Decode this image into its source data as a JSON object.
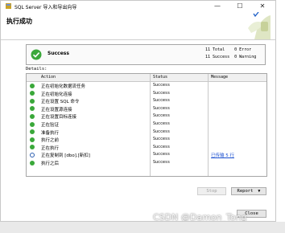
{
  "window": {
    "title": "SQL Server 导入和导出向导",
    "minimize": "—",
    "maximize": "☐",
    "close": "✕"
  },
  "header": {
    "heading": "执行成功"
  },
  "summary": {
    "status": "Success",
    "total_line": "11 Total    0 Error",
    "success_line": "11 Success  0 Warning"
  },
  "details": {
    "label": "Details:",
    "columns": {
      "action": "Action",
      "status": "Status",
      "message": "Message"
    },
    "rows": [
      {
        "icon": "success-icon",
        "action": "正在初始化数据流任务",
        "status": "Success",
        "message": ""
      },
      {
        "icon": "success-icon",
        "action": "正在初始化连接",
        "status": "Success",
        "message": ""
      },
      {
        "icon": "success-icon",
        "action": "正在设置 SQL 命令",
        "status": "Success",
        "message": ""
      },
      {
        "icon": "success-icon",
        "action": "正在设置源连接",
        "status": "Success",
        "message": ""
      },
      {
        "icon": "success-icon",
        "action": "正在设置目标连接",
        "status": "Success",
        "message": ""
      },
      {
        "icon": "success-icon",
        "action": "正在验证",
        "status": "Success",
        "message": ""
      },
      {
        "icon": "success-icon",
        "action": "准备执行",
        "status": "Success",
        "message": ""
      },
      {
        "icon": "success-icon",
        "action": "执行之前",
        "status": "Success",
        "message": ""
      },
      {
        "icon": "success-icon",
        "action": "正在执行",
        "status": "Success",
        "message": ""
      },
      {
        "icon": "info-icon",
        "action": "正在复制到 [dbo].[新扣]",
        "status": "Success",
        "message": "已传输 5 行"
      },
      {
        "icon": "success-icon",
        "action": "执行之后",
        "status": "Success",
        "message": ""
      }
    ]
  },
  "buttons": {
    "stop": "Stop",
    "report": "Report",
    "close": "Close"
  },
  "watermark": "CSDN @Damon_Tong",
  "colors": {
    "success": "#3aa83a",
    "link": "#1a4fd0"
  }
}
